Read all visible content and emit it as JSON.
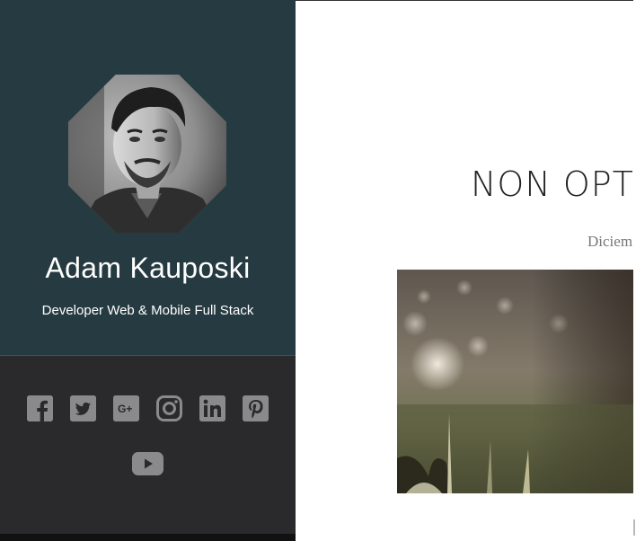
{
  "profile": {
    "name": "Adam Kauposki",
    "role": "Developer Web & Mobile Full Stack"
  },
  "social": [
    {
      "icon": "facebook-icon",
      "glyph": "f"
    },
    {
      "icon": "twitter-icon",
      "glyph": ""
    },
    {
      "icon": "google-plus-icon",
      "glyph": "G+"
    },
    {
      "icon": "instagram-icon",
      "glyph": ""
    },
    {
      "icon": "linkedin-icon",
      "glyph": "in"
    },
    {
      "icon": "pinterest-icon",
      "glyph": "P"
    },
    {
      "icon": "youtube-icon",
      "glyph": ""
    }
  ],
  "post": {
    "title": "NON OPTI",
    "date": "Diciem"
  },
  "colors": {
    "profile_bg": "#263b41",
    "sidebar_bg": "#2a2a2c",
    "icon": "#8a8a8c"
  }
}
